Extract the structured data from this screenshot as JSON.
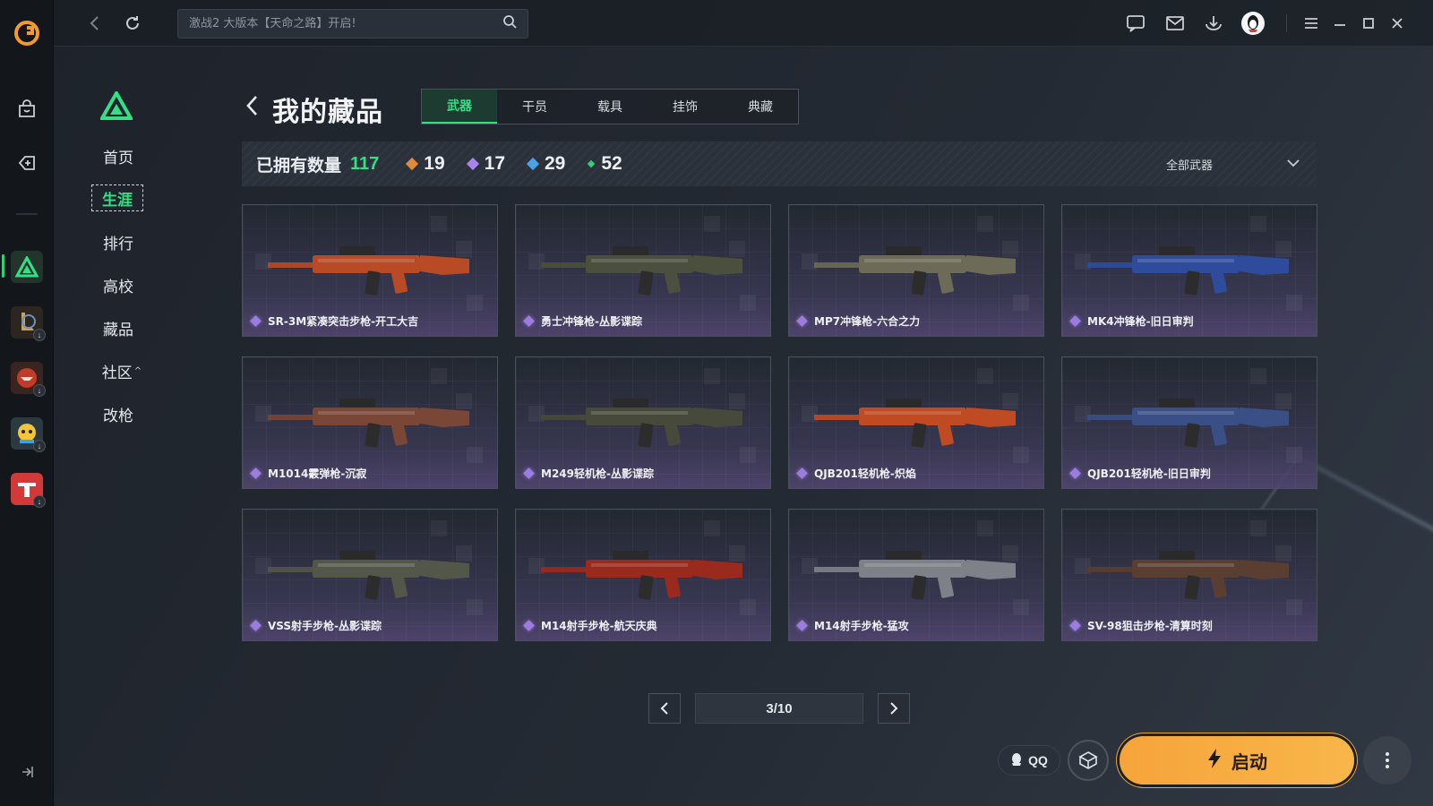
{
  "topbar": {
    "search_placeholder": "激战2 大版本【天命之路】开启!"
  },
  "sidebar_nav": {
    "items": [
      {
        "label": "首页"
      },
      {
        "label": "生涯"
      },
      {
        "label": "排行"
      },
      {
        "label": "高校"
      },
      {
        "label": "藏品"
      },
      {
        "label": "社区"
      },
      {
        "label": "改枪"
      }
    ],
    "active_index": 1
  },
  "header": {
    "title": "我的藏品",
    "tabs": [
      {
        "label": "武器"
      },
      {
        "label": "干员"
      },
      {
        "label": "载具"
      },
      {
        "label": "挂饰"
      },
      {
        "label": "典藏"
      }
    ],
    "active_tab": 0
  },
  "stats": {
    "owned_label": "已拥有数量",
    "owned_count": "117",
    "rarity": [
      {
        "count": "19",
        "color": "#e08a3c"
      },
      {
        "count": "17",
        "color": "#a585ec"
      },
      {
        "count": "29",
        "color": "#4aa3e8"
      },
      {
        "count": "52",
        "color": "#34d07a"
      }
    ],
    "filter_label": "全部武器"
  },
  "items": [
    {
      "name": "SR-3M紧凑突击步枪-开工大吉",
      "tint": "#b84a26"
    },
    {
      "name": "勇士冲锋枪-丛影谍踪",
      "tint": "#4b4f3e"
    },
    {
      "name": "MP7冲锋枪-六合之力",
      "tint": "#6e6a58"
    },
    {
      "name": "MK4冲锋枪-旧日审判",
      "tint": "#2f4c9c"
    },
    {
      "name": "M1014霰弹枪-沉寂",
      "tint": "#7a4636"
    },
    {
      "name": "M249轻机枪-丛影谍踪",
      "tint": "#474a3b"
    },
    {
      "name": "QJB201轻机枪-炽焰",
      "tint": "#c04a22"
    },
    {
      "name": "QJB201轻机枪-旧日审判",
      "tint": "#3a4f86"
    },
    {
      "name": "VSS射手步枪-丛影谍踪",
      "tint": "#53574a"
    },
    {
      "name": "M14射手步枪-航天庆典",
      "tint": "#9a2a1e"
    },
    {
      "name": "M14射手步枪-猛攻",
      "tint": "#7e8288"
    },
    {
      "name": "SV-98狙击步枪-清算时刻",
      "tint": "#5a3e32"
    }
  ],
  "pagination": {
    "text": "3/10"
  },
  "bottom": {
    "qq_label": "QQ",
    "launch_label": "启动"
  },
  "colors": {
    "accent": "#34e083",
    "launch": "#f6a43a"
  }
}
